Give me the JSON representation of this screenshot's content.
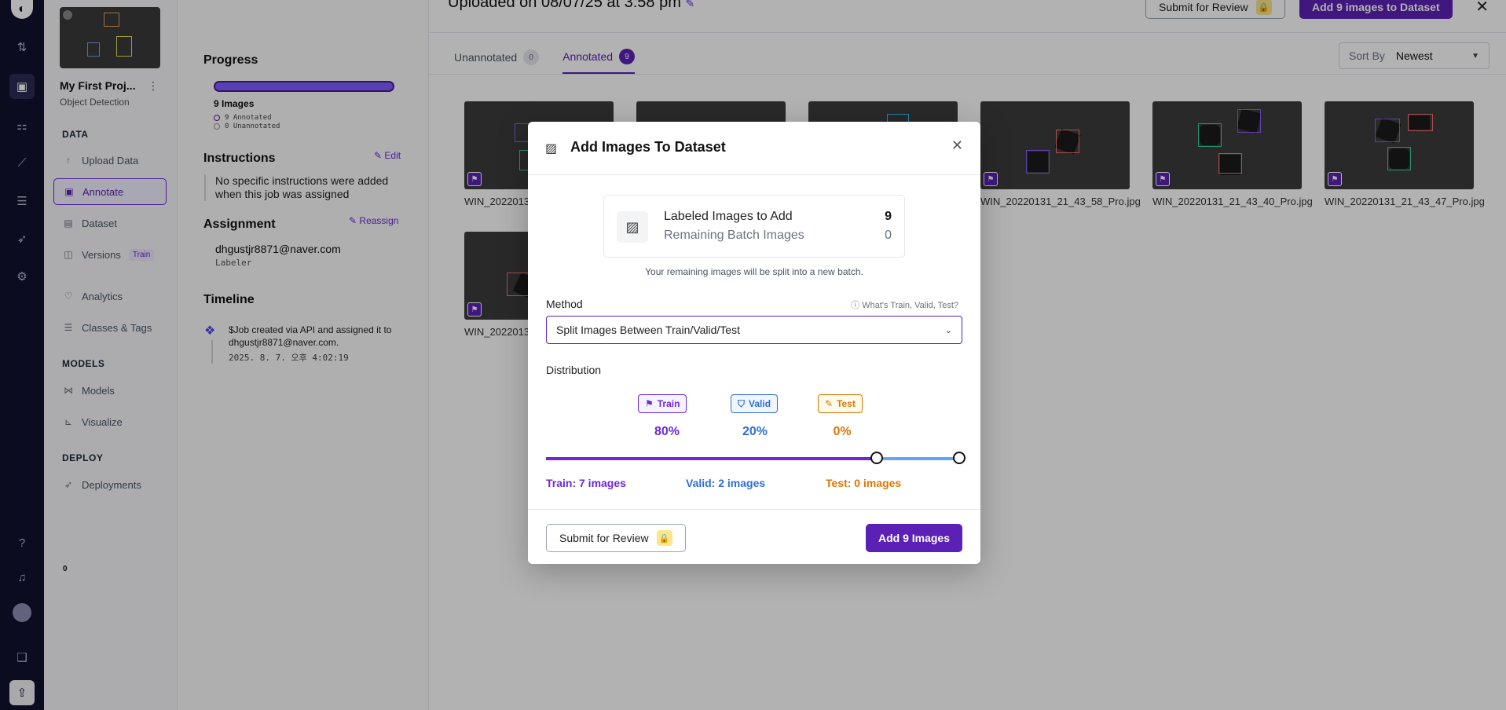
{
  "rail": {
    "icons": [
      "logo-icon",
      "transfer-icon",
      "inbox-icon",
      "workflow-icon",
      "chart-icon",
      "layers-icon",
      "rocket-icon",
      "settings-icon",
      "help-icon",
      "bell-icon",
      "avatar",
      "stack-icon",
      "upload-icon"
    ]
  },
  "sidebar": {
    "project_title": "My First Proj...",
    "project_type": "Object Detection",
    "sections": {
      "data": "DATA",
      "models": "MODELS",
      "deploy": "DEPLOY"
    },
    "items": [
      {
        "label": "Upload Data",
        "icon": "upload-icon"
      },
      {
        "label": "Annotate",
        "icon": "annotate-icon"
      },
      {
        "label": "Dataset",
        "icon": "dataset-icon",
        "count": "0"
      },
      {
        "label": "Versions",
        "icon": "versions-icon",
        "tag": "Train"
      },
      {
        "label": "Analytics",
        "icon": "analytics-icon"
      },
      {
        "label": "Classes & Tags",
        "icon": "list-icon"
      },
      {
        "label": "Models",
        "icon": "models-icon"
      },
      {
        "label": "Visualize",
        "icon": "visualize-icon"
      },
      {
        "label": "Deployments",
        "icon": "rocket-icon"
      }
    ]
  },
  "job": {
    "progress_title": "Progress",
    "progress_fraction": 1.0,
    "images_label": "9 Images",
    "annotated_label": "9 Annotated",
    "unannotated_label": "0 Unannotated",
    "instructions_title": "Instructions",
    "edit_label": "Edit",
    "instructions_text": "No specific instructions were added when this job was assigned",
    "assignment_title": "Assignment",
    "reassign_label": "Reassign",
    "assignee": "dhgustjr8871@naver.com",
    "role": "Labeler",
    "timeline_title": "Timeline",
    "timeline_text": "$Job created via API and assigned it to dhgustjr8871@naver.com.",
    "timeline_time": "2025. 8. 7. 오후 4:02:19"
  },
  "header": {
    "title": "Uploaded on 08/07/25 at 3:58 pm",
    "submit_label": "Submit for Review",
    "add_label": "Add 9 images to Dataset"
  },
  "tabs": [
    {
      "label": "Unannotated",
      "count": "0"
    },
    {
      "label": "Annotated",
      "count": "9"
    }
  ],
  "sort": {
    "label": "Sort By",
    "value": "Newest"
  },
  "images": [
    {
      "name": "WIN_2022013"
    },
    {
      "name": ""
    },
    {
      "name": ""
    },
    {
      "name": "WIN_20220131_21_43_58_Pro.jpg"
    },
    {
      "name": "WIN_20220131_21_43_40_Pro.jpg"
    },
    {
      "name": "WIN_20220131_21_43_47_Pro.jpg"
    },
    {
      "name": "WIN_2022013"
    }
  ],
  "modal": {
    "title": "Add Images To Dataset",
    "labeled_label": "Labeled Images to Add",
    "labeled_value": "9",
    "remaining_label": "Remaining Batch Images",
    "remaining_value": "0",
    "note": "Your remaining images will be split into a new batch.",
    "method_label": "Method",
    "help_label": "What's Train, Valid, Test?",
    "method_value": "Split Images Between Train/Valid/Test",
    "distribution_label": "Distribution",
    "train": {
      "label": "Train",
      "pct": "80%",
      "count": "Train: 7 images",
      "color": "#6d28d9"
    },
    "valid": {
      "label": "Valid",
      "pct": "20%",
      "count": "Valid: 2 images",
      "color": "#2f6fd6"
    },
    "test": {
      "label": "Test",
      "pct": "0%",
      "count": "Test: 0 images",
      "color": "#d97706"
    },
    "split": {
      "train": 0.8,
      "valid": 0.2,
      "test": 0.0
    },
    "submit_label": "Submit for Review",
    "add_label": "Add 9 Images"
  }
}
